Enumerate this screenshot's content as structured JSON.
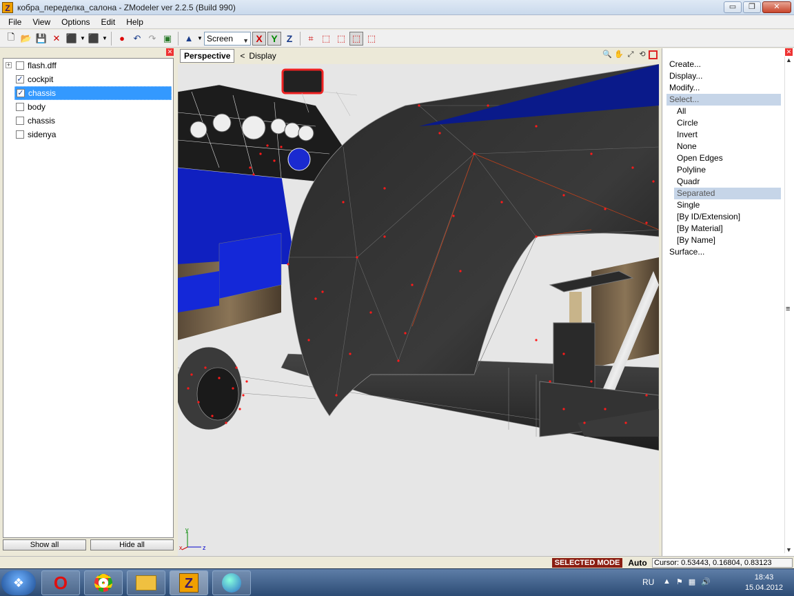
{
  "window": {
    "title": "кобра_переделка_салона - ZModeler ver 2.2.5 (Build 990)",
    "app_icon_letter": "Z",
    "buttons": {
      "minimize": "▭",
      "restore": "❐",
      "close": "✕"
    }
  },
  "menu": [
    "File",
    "View",
    "Options",
    "Edit",
    "Help"
  ],
  "toolbar": {
    "coordinate_mode": "Screen",
    "axes": [
      "X",
      "Y",
      "Z"
    ]
  },
  "object_tree": {
    "items": [
      {
        "label": "flash.dff",
        "checked": false,
        "expandable": true,
        "selected": false
      },
      {
        "label": "cockpit",
        "checked": true,
        "expandable": false,
        "selected": false
      },
      {
        "label": "chassis",
        "checked": true,
        "expandable": false,
        "selected": true
      },
      {
        "label": "body",
        "checked": false,
        "expandable": false,
        "selected": false
      },
      {
        "label": "chassis",
        "checked": false,
        "expandable": false,
        "selected": false
      },
      {
        "label": "sidenya",
        "checked": false,
        "expandable": false,
        "selected": false
      }
    ],
    "show_all": "Show all",
    "hide_all": "Hide all"
  },
  "viewport": {
    "tab": "Perspective",
    "back_arrow": "<",
    "menu_label": "Display",
    "gizmo_x": "x",
    "gizmo_y": "y",
    "gizmo_z": "z"
  },
  "command_panel": {
    "items": [
      {
        "label": "Create...",
        "sub": false,
        "active": false
      },
      {
        "label": "Display...",
        "sub": false,
        "active": false
      },
      {
        "label": "Modify...",
        "sub": false,
        "active": false
      },
      {
        "label": "Select...",
        "sub": false,
        "active": true
      },
      {
        "label": "All",
        "sub": true,
        "active": false
      },
      {
        "label": "Circle",
        "sub": true,
        "active": false
      },
      {
        "label": "Invert",
        "sub": true,
        "active": false
      },
      {
        "label": "None",
        "sub": true,
        "active": false
      },
      {
        "label": "Open Edges",
        "sub": true,
        "active": false
      },
      {
        "label": "Polyline",
        "sub": true,
        "active": false
      },
      {
        "label": "Quadr",
        "sub": true,
        "active": false
      },
      {
        "label": "Separated",
        "sub": true,
        "active": true
      },
      {
        "label": "Single",
        "sub": true,
        "active": false
      },
      {
        "label": "[By ID/Extension]",
        "sub": true,
        "active": false
      },
      {
        "label": "[By Material]",
        "sub": true,
        "active": false
      },
      {
        "label": "[By Name]",
        "sub": true,
        "active": false
      },
      {
        "label": "Surface...",
        "sub": false,
        "active": false
      }
    ]
  },
  "statusbar": {
    "mode": "SELECTED MODE",
    "auto": "Auto",
    "cursor": "Cursor: 0.53443, 0.16804, 0.83123"
  },
  "taskbar": {
    "lang": "RU",
    "time": "18:43",
    "date": "15.04.2012",
    "apps": [
      "opera-icon",
      "chrome-icon",
      "explorer-icon",
      "zmodeler-icon",
      "globe-icon"
    ]
  },
  "colors": {
    "selection": "#3399ff",
    "selected_mode_bg": "#8b1e12",
    "vertex_red": "#ff1a1a",
    "blue_panel": "#1020c0"
  }
}
